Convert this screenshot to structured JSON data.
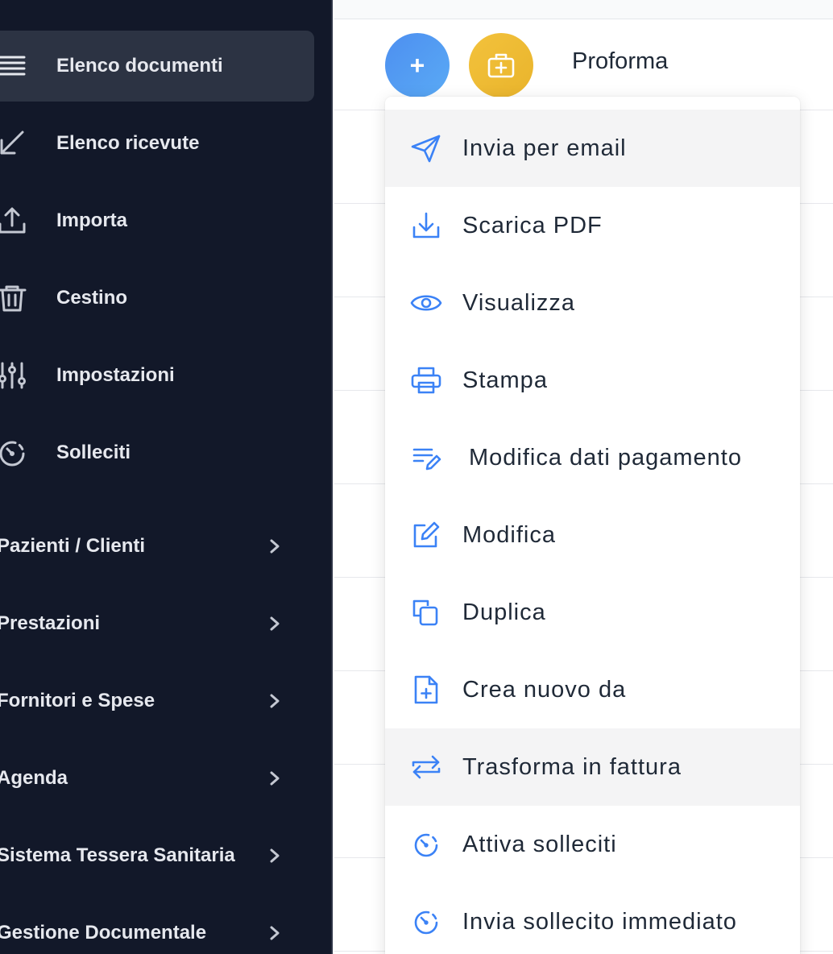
{
  "sidebar": {
    "items": [
      {
        "label": "Elenco documenti"
      },
      {
        "label": "Elenco ricevute"
      },
      {
        "label": "Importa"
      },
      {
        "label": "Cestino"
      },
      {
        "label": "Impostazioni"
      },
      {
        "label": "Solleciti"
      }
    ],
    "groups": [
      {
        "label": "Pazienti / Clienti"
      },
      {
        "label": "Prestazioni"
      },
      {
        "label": "Fornitori e Spese"
      },
      {
        "label": "Agenda"
      },
      {
        "label": "Sistema Tessera Sanitaria"
      },
      {
        "label": "Gestione Documentale"
      }
    ]
  },
  "header": {
    "add_label": "+",
    "doc_type": "Proforma"
  },
  "menu": {
    "items": [
      {
        "label": "Invia per email",
        "icon": "send-icon"
      },
      {
        "label": "Scarica PDF",
        "icon": "download-icon"
      },
      {
        "label": "Visualizza",
        "icon": "eye-icon"
      },
      {
        "label": "Stampa",
        "icon": "printer-icon"
      },
      {
        "label": "Modifica dati pagamento",
        "icon": "edit-list-icon"
      },
      {
        "label": "Modifica",
        "icon": "pencil-square-icon"
      },
      {
        "label": "Duplica",
        "icon": "copy-icon"
      },
      {
        "label": "Crea nuovo da",
        "icon": "file-plus-icon"
      },
      {
        "label": "Trasforma in fattura",
        "icon": "swap-icon"
      },
      {
        "label": "Attiva solleciti",
        "icon": "timer-icon"
      },
      {
        "label": "Invia sollecito immediato",
        "icon": "timer-icon"
      }
    ]
  },
  "colors": {
    "sidebar_bg": "#121829",
    "accent_blue": "#4d8ff0",
    "accent_yellow": "#f3c23c",
    "icon_blue": "#3b82f6"
  }
}
